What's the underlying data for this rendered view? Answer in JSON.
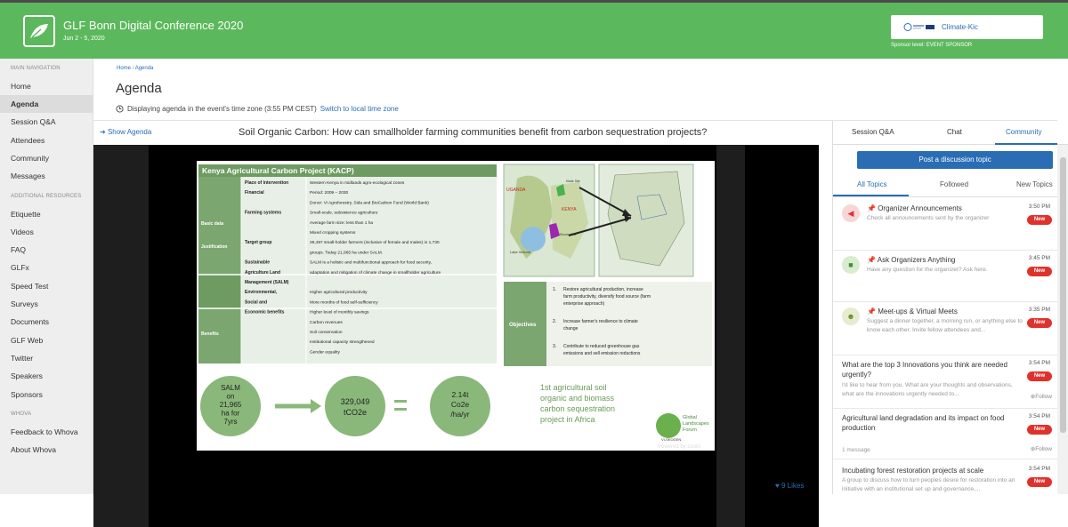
{
  "header": {
    "title": "GLF Bonn Digital Conference 2020",
    "dates": "Jun 2 - 5, 2020",
    "sponsor_name": "Climate-Kic",
    "sponsor_level": "Sponsor level: EVENT SPONSOR",
    "brand_color": "#5cb85c"
  },
  "sidebar": {
    "main_nav_heading": "MAIN NAVIGATION",
    "main_items": [
      "Home",
      "Agenda",
      "Session Q&A",
      "Attendees",
      "Community",
      "Messages"
    ],
    "resources_heading": "ADDITIONAL RESOURCES",
    "resource_items": [
      "Etiquette",
      "Videos",
      "FAQ",
      "GLFx",
      "Speed Test",
      "Surveys",
      "Documents",
      "GLF Web",
      "Twitter",
      "Speakers",
      "Sponsors"
    ],
    "whova_heading": "WHOVA",
    "whova_items": [
      "Feedback to Whova",
      "About Whova"
    ]
  },
  "breadcrumb": {
    "home": "Home",
    "sep": "/",
    "current": "Agenda"
  },
  "page": {
    "title": "Agenda",
    "timezone_text": "Displaying agenda in the event's time zone (3:55 PM CEST)",
    "timezone_link": "Switch to local time zone",
    "show_agenda": "Show Agenda",
    "session_title": "Soil Organic Carbon: How can smallholder farming communities benefit from carbon sequestration projects?",
    "likes": "9 Likes"
  },
  "slide": {
    "title": "Kenya Agricultural Carbon Project (KACP)",
    "rows": [
      {
        "section": "Basic data",
        "label": "Place of intervention",
        "value": "Western Kenya in midlands agro-ecological zones"
      },
      {
        "section": "",
        "label": "Financial",
        "value": "Period: 2009 – 2030"
      },
      {
        "section": "",
        "label": "",
        "value": "Donor: Vi Agroforestry, Sida and BioCarbon Fund (World Bank)"
      },
      {
        "section": "",
        "label": "Farming systems",
        "value": "Small-scale, subsistence agriculture"
      },
      {
        "section": "",
        "label": "",
        "value": "Average farm size: less than 1 ha"
      },
      {
        "section": "",
        "label": "",
        "value": "Mixed cropping systems"
      },
      {
        "section": "",
        "label": "Target group",
        "value": "29,497 small-holder farmers (inclusive of female and males) in 1,730"
      },
      {
        "section": "",
        "label": "",
        "value": "groups. Today 21,965 ha under SALM."
      },
      {
        "section": "Justification",
        "label": "Sustainable",
        "value": "SALM is a holistic and multifunctional approach for food security,"
      },
      {
        "section": "",
        "label": "Agriculture Land",
        "value": "adaptation and mitigation of climate change in smallholder agriculture"
      },
      {
        "section": "",
        "label": "Management (SALM)",
        "value": ""
      },
      {
        "section": "Benefits",
        "label": "Environmental,",
        "value": "Higher agricultural productivity"
      },
      {
        "section": "",
        "label": "Social and",
        "value": "More months of food self-sufficiency"
      },
      {
        "section": "",
        "label": "Economic benefits",
        "value": "Higher level of monthly savings"
      },
      {
        "section": "",
        "label": "",
        "value": "Carbon revenues"
      },
      {
        "section": "",
        "label": "",
        "value": "Soil conservation"
      },
      {
        "section": "",
        "label": "",
        "value": "Institutional capacity strengthened"
      },
      {
        "section": "",
        "label": "",
        "value": "Gender equality"
      }
    ],
    "map_labels": [
      "UGANDA",
      "KENYA",
      "Lake Victoria",
      "Kitale Site",
      "Kisumu Site"
    ],
    "objectives_label": "Objectives",
    "objectives": [
      {
        "n": "1.",
        "lines": [
          "Restore agricultural production, increase",
          "farm productivity, diversify food source (farm",
          "enterprise approach)"
        ]
      },
      {
        "n": "2.",
        "lines": [
          "Increase farmer's resilience to climate",
          "change"
        ]
      },
      {
        "n": "3.",
        "lines": [
          "Contribute to reduced greenhouse gas",
          "emissions and sell emission reductions"
        ]
      }
    ],
    "circle1": [
      "SALM",
      "on",
      "21,965",
      "ha for",
      "7yrs"
    ],
    "circle2": [
      "329,049",
      "tCO2e"
    ],
    "circle3": [
      "2.14t",
      "Co2e",
      "/ha/yr"
    ],
    "summary": [
      "1st agricultural soil",
      "organic and biomass",
      "carbon sequestration",
      "project in Africa"
    ],
    "logo_text": [
      "Global",
      "Landscapes",
      "Forum"
    ],
    "logo_small": "VI-SKOGEN",
    "watermark": "Powered by zoom"
  },
  "right_panel": {
    "tabs": [
      "Session Q&A",
      "Chat",
      "Community"
    ],
    "post_button": "Post a discussion topic",
    "subtabs": [
      "All Topics",
      "Followed",
      "New Topics"
    ],
    "topics": [
      {
        "title": "Organizer Announcements",
        "desc": "Check all announcements sent by the organizer",
        "time": "3:50 PM",
        "badge": "New",
        "pinned": true,
        "icon": "megaphone-icon"
      },
      {
        "title": "Ask Organizers Anything",
        "desc": "Have any question for the organizer? Ask here.",
        "time": "3:45 PM",
        "badge": "New",
        "pinned": true,
        "icon": "chat-icon"
      },
      {
        "title": "Meet-ups & Virtual Meets",
        "desc": "Suggest a dinner together, a morning run, or anything else to know each other. Invite fellow attendees and...",
        "time": "3:35 PM",
        "badge": "New",
        "pinned": true,
        "icon": "people-icon"
      },
      {
        "title": "What are the top 3 Innovations you think are needed urgently?",
        "desc": "I'd like to hear from you. What are your thoughts and observations, what are the innovations urgently needed to...",
        "time": "3:54 PM",
        "badge": "New",
        "follow": "Follow"
      },
      {
        "title": "Agricultural land degradation and its impact on food production",
        "desc": "1 message",
        "time": "3:54 PM",
        "badge": "New",
        "follow": "Follow"
      },
      {
        "title": "Incubating forest restoration projects at scale",
        "desc": "A group to discuss how to turn peoples desire for restoration into an initiative with an institutional set up and governance,...",
        "time": "3:54 PM",
        "badge": "New"
      }
    ]
  }
}
